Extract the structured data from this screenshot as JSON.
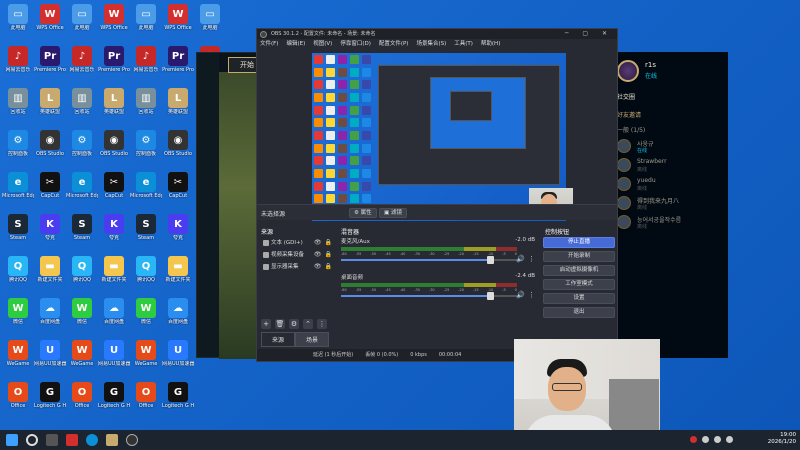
{
  "desktop": {
    "icons": [
      {
        "label": "此电脑",
        "color": "#4a9be8",
        "glyph": "▭"
      },
      {
        "label": "网易云音乐",
        "color": "#c62828",
        "glyph": "♪"
      },
      {
        "label": "回收站",
        "color": "#78909c",
        "glyph": "▥"
      },
      {
        "label": "控制面板",
        "color": "#1e88e5",
        "glyph": "⚙"
      },
      {
        "label": "Microsoft Edge",
        "color": "#0b8fd6",
        "glyph": "e"
      },
      {
        "label": "Steam",
        "color": "#1b2838",
        "glyph": "S"
      },
      {
        "label": "腾讯QQ",
        "color": "#29b6f6",
        "glyph": "Q"
      },
      {
        "label": "微信",
        "color": "#2ecc40",
        "glyph": "W"
      },
      {
        "label": "WeGame",
        "color": "#e64a19",
        "glyph": "W"
      },
      {
        "label": "Office",
        "color": "#e64a19",
        "glyph": "O"
      },
      {
        "label": "WPS Office",
        "color": "#d32f2f",
        "glyph": "W"
      },
      {
        "label": "Premiere Pro",
        "color": "#2a1a6e",
        "glyph": "Pr"
      },
      {
        "label": "英雄联盟",
        "color": "#c8aa6e",
        "glyph": "L"
      },
      {
        "label": "OBS Studio",
        "color": "#333",
        "glyph": "◉"
      },
      {
        "label": "CapCut",
        "color": "#111",
        "glyph": "✂"
      },
      {
        "label": "夸克",
        "color": "#4a3cf0",
        "glyph": "K"
      },
      {
        "label": "新建文件夹",
        "color": "#f4c64e",
        "glyph": "▬"
      },
      {
        "label": "百度网盘",
        "color": "#2a8ef0",
        "glyph": "☁"
      },
      {
        "label": "网易UU加速器",
        "color": "#2979ff",
        "glyph": "U"
      },
      {
        "label": "Logitech G HUB",
        "color": "#111",
        "glyph": "G"
      }
    ]
  },
  "lol": {
    "play_label": "开始",
    "friends": {
      "name": "r1s",
      "status": "在线",
      "header": "社交圈",
      "section": "好友邀请",
      "group": "一般 (1/5)",
      "items": [
        {
          "name": "사웅규",
          "status": "在线"
        },
        {
          "name": "Strawberr",
          "status": "离线"
        },
        {
          "name": "yuedu",
          "status": "离线"
        },
        {
          "name": "得到我来九月八",
          "status": "离线"
        },
        {
          "name": "능어서공을작수름",
          "status": "离线"
        }
      ]
    }
  },
  "obs": {
    "title": "OBS 30.1.2 - 配置文件: 未命名 - 场景: 未命名",
    "menu": [
      "文件(F)",
      "编辑(E)",
      "视图(V)",
      "停靠窗口(D)",
      "配置文件(P)",
      "场景集合(S)",
      "工具(T)",
      "帮助(H)"
    ],
    "no_scene": "未选择源",
    "props_btn": "⚙ 属性",
    "filters_btn": "▣ 滤镜",
    "sources_title": "来源",
    "sources": [
      "文本 (GDI+)",
      "视频采集设备",
      "显示器采集"
    ],
    "mixer_title": "混音器",
    "channels": [
      {
        "name": "麦克风/Aux",
        "db": "-2.0 dB"
      },
      {
        "name": "桌面音频",
        "db": "-2.4 dB"
      }
    ],
    "scale": [
      "-60",
      "-55",
      "-50",
      "-45",
      "-40",
      "-35",
      "-30",
      "-25",
      "-20",
      "-15",
      "-10",
      "-5",
      "0"
    ],
    "controls_title": "控制按钮",
    "controls": [
      "停止直播",
      "开始录制",
      "启动虚拟摄像机",
      "工作室模式",
      "设置",
      "退出"
    ],
    "scene_tabs": [
      "来源",
      "场景"
    ],
    "status": {
      "delay": "延迟 (1 秒后开始)",
      "dropped": "丢帧 0 (0.0%)",
      "kbps": "0 kbps",
      "time": "00:00:04"
    }
  },
  "tray": {
    "time": "19:00",
    "date": "2026/1/20"
  }
}
